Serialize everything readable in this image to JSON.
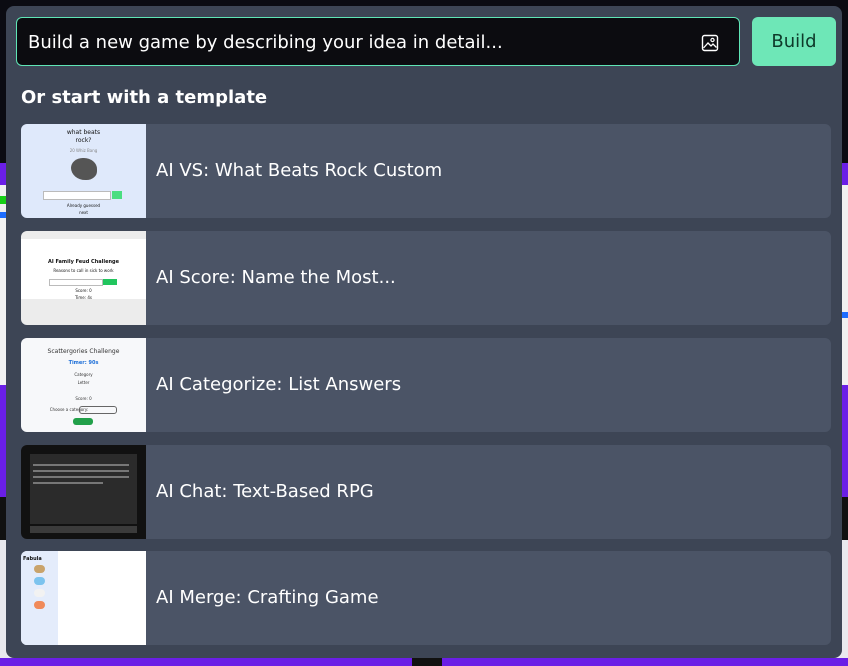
{
  "prompt": {
    "placeholder": "Build a new game by describing your idea in detail..."
  },
  "build_button": {
    "label": "Build"
  },
  "templates_section": {
    "title": "Or start with a template",
    "items": [
      {
        "label": "AI VS: What Beats Rock Custom",
        "thumb": {
          "title_line1": "what beats",
          "title_line2": "rock?",
          "sub": "20 Whiz Bang",
          "button": "GO",
          "footer1": "Already guessed",
          "footer2": "next"
        }
      },
      {
        "label": "AI Score: Name the Most...",
        "thumb": {
          "title": "AI Family Feud Challenge",
          "sub": "Reasons to call in sick to work",
          "placeholder": "Enter your answer",
          "button": "Submit",
          "score": "Score: 0",
          "time": "Time: 4s"
        }
      },
      {
        "label": "AI Categorize: List Answers",
        "thumb": {
          "title": "Scattergories Challenge",
          "timer": "Timer: 90s",
          "category": "Category",
          "letter": "Letter",
          "score": "Score: 0",
          "choose": "Choose a category:",
          "button": "Start Game"
        }
      },
      {
        "label": "AI Chat: Text-Based RPG",
        "thumb": {
          "input": "Enter command..."
        }
      },
      {
        "label": "AI Merge: Crafting Game",
        "thumb": {
          "title": "Fabula"
        }
      }
    ]
  },
  "colors": {
    "modal_bg": "#3d4555",
    "card_bg": "#4b5466",
    "accent": "#6ee7b7",
    "input_border": "#5fe6b6"
  },
  "icons": {
    "image_upload": "image-icon"
  }
}
